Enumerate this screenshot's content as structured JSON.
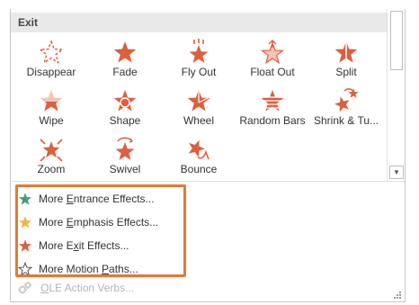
{
  "gallery": {
    "section_title": "Exit",
    "accent_color": "#dd5f3f",
    "effects": [
      {
        "label": "Disappear",
        "icon": "disappear-star-icon"
      },
      {
        "label": "Fade",
        "icon": "fade-star-icon"
      },
      {
        "label": "Fly Out",
        "icon": "fly-out-star-icon"
      },
      {
        "label": "Float Out",
        "icon": "float-out-star-icon"
      },
      {
        "label": "Split",
        "icon": "split-star-icon"
      },
      {
        "label": "Wipe",
        "icon": "wipe-star-icon"
      },
      {
        "label": "Shape",
        "icon": "shape-star-icon"
      },
      {
        "label": "Wheel",
        "icon": "wheel-star-icon"
      },
      {
        "label": "Random Bars",
        "icon": "random-bars-star-icon"
      },
      {
        "label": "Shrink & Tu...",
        "icon": "shrink-turn-star-icon"
      },
      {
        "label": "Zoom",
        "icon": "zoom-star-icon"
      },
      {
        "label": "Swivel",
        "icon": "swivel-star-icon"
      },
      {
        "label": "Bounce",
        "icon": "bounce-star-icon"
      }
    ]
  },
  "more_effects": [
    {
      "label": "More Entrance Effects...",
      "access_key": "E",
      "icon": "green-star-icon",
      "color": "#3f9e7c"
    },
    {
      "label": "More Emphasis Effects...",
      "access_key": "E",
      "icon": "gold-star-icon",
      "color": "#f2b548"
    },
    {
      "label": "More Exit Effects...",
      "access_key": "x",
      "icon": "red-star-icon",
      "color": "#dd5f3f"
    },
    {
      "label": "More Motion Paths...",
      "access_key": "P",
      "icon": "outline-star-icon",
      "color": "#555555"
    }
  ],
  "ole": {
    "label": "OLE Action Verbs...",
    "icon": "gears-icon",
    "disabled": true
  },
  "highlight_color": "#e07b35"
}
